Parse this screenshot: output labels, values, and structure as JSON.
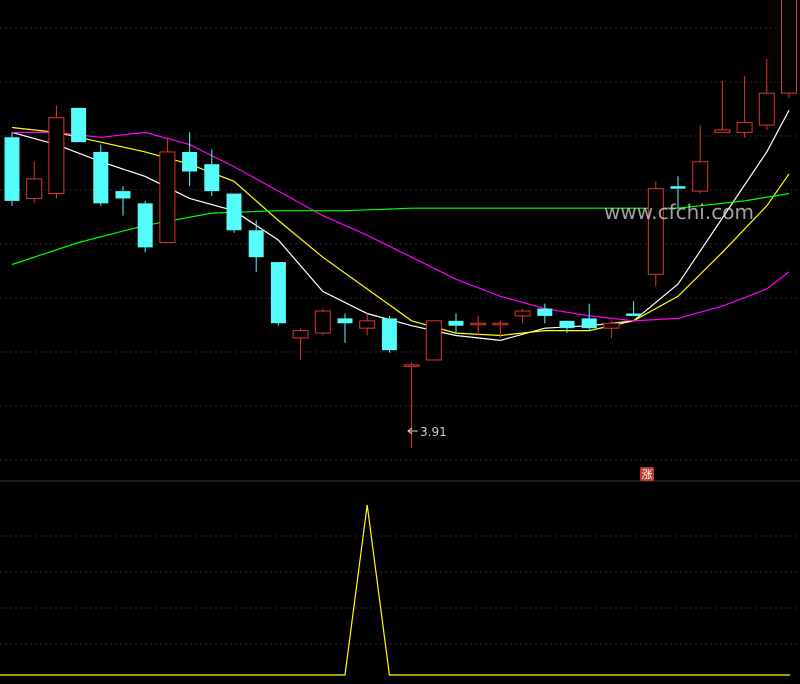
{
  "watermark": "www.cfchi.com",
  "badge": {
    "label": "涨",
    "color": "#c0392b"
  },
  "low_marker": {
    "label": "3.91",
    "value": 3.91
  },
  "colors": {
    "background": "#000000",
    "grid": "#2a2a2a",
    "rise": "#e03434",
    "fall": "#54fcfc",
    "ma5": "#ffffff",
    "ma10": "#ffff00",
    "ma20": "#ff00ff",
    "ma60": "#00ff00",
    "indicator": "#ffff00"
  },
  "chart_data": [
    {
      "type": "candlestick",
      "price_range": [
        3.8,
        5.7
      ],
      "gridlines": "horizontal-dashed",
      "candles": [
        {
          "o": 5.18,
          "h": 5.2,
          "c": 4.92,
          "l": 4.9
        },
        {
          "o": 4.93,
          "h": 5.08,
          "c": 5.01,
          "l": 4.91
        },
        {
          "o": 4.95,
          "h": 5.31,
          "c": 5.26,
          "l": 4.93
        },
        {
          "o": 5.3,
          "h": 5.3,
          "c": 5.16,
          "l": 5.16
        },
        {
          "o": 5.12,
          "h": 5.15,
          "c": 4.91,
          "l": 4.9
        },
        {
          "o": 4.96,
          "h": 4.98,
          "c": 4.93,
          "l": 4.86
        },
        {
          "o": 4.91,
          "h": 4.92,
          "c": 4.73,
          "l": 4.71
        },
        {
          "o": 4.75,
          "h": 5.18,
          "c": 5.12,
          "l": 4.75
        },
        {
          "o": 5.12,
          "h": 5.2,
          "c": 5.04,
          "l": 4.98
        },
        {
          "o": 5.07,
          "h": 5.13,
          "c": 4.96,
          "l": 4.94
        },
        {
          "o": 4.95,
          "h": 4.95,
          "c": 4.8,
          "l": 4.79
        },
        {
          "o": 4.8,
          "h": 4.84,
          "c": 4.69,
          "l": 4.63
        },
        {
          "o": 4.67,
          "h": 4.67,
          "c": 4.42,
          "l": 4.41
        },
        {
          "o": 4.36,
          "h": 4.4,
          "c": 4.39,
          "l": 4.27
        },
        {
          "o": 4.38,
          "h": 4.48,
          "c": 4.47,
          "l": 4.37
        },
        {
          "o": 4.44,
          "h": 4.46,
          "c": 4.42,
          "l": 4.34
        },
        {
          "o": 4.4,
          "h": 4.46,
          "c": 4.43,
          "l": 4.37
        },
        {
          "o": 4.44,
          "h": 4.45,
          "c": 4.31,
          "l": 4.3
        },
        {
          "o": 4.25,
          "h": 4.26,
          "c": 4.25,
          "l": 3.91
        },
        {
          "o": 4.27,
          "h": 4.43,
          "c": 4.43,
          "l": 4.27
        },
        {
          "o": 4.43,
          "h": 4.46,
          "c": 4.41,
          "l": 4.38
        },
        {
          "o": 4.42,
          "h": 4.45,
          "c": 4.42,
          "l": 4.37
        },
        {
          "o": 4.42,
          "h": 4.43,
          "c": 4.42,
          "l": 4.36
        },
        {
          "o": 4.45,
          "h": 4.48,
          "c": 4.47,
          "l": 4.42
        },
        {
          "o": 4.48,
          "h": 4.5,
          "c": 4.45,
          "l": 4.42
        },
        {
          "o": 4.43,
          "h": 4.43,
          "c": 4.4,
          "l": 4.38
        },
        {
          "o": 4.44,
          "h": 4.5,
          "c": 4.4,
          "l": 4.39
        },
        {
          "o": 4.4,
          "h": 4.43,
          "c": 4.42,
          "l": 4.36
        },
        {
          "o": 4.46,
          "h": 4.51,
          "c": 4.45,
          "l": 4.45
        },
        {
          "o": 4.62,
          "h": 5.0,
          "c": 4.97,
          "l": 4.57
        },
        {
          "o": 4.98,
          "h": 5.02,
          "c": 4.97,
          "l": 4.89
        },
        {
          "o": 4.96,
          "h": 5.23,
          "c": 5.08,
          "l": 4.95
        },
        {
          "o": 5.2,
          "h": 5.41,
          "c": 5.21,
          "l": 5.2
        },
        {
          "o": 5.2,
          "h": 5.43,
          "c": 5.24,
          "l": 5.18
        },
        {
          "o": 5.23,
          "h": 5.5,
          "c": 5.36,
          "l": 5.21
        },
        {
          "o": 5.36,
          "h": 5.8,
          "c": 5.8,
          "l": 5.34
        }
      ],
      "moving_averages": [
        {
          "key": "ma5",
          "values": [
            [
              0,
              5.2
            ],
            [
              2,
              5.15
            ],
            [
              4,
              5.08
            ],
            [
              6,
              5.02
            ],
            [
              8,
              4.93
            ],
            [
              10,
              4.88
            ],
            [
              12,
              4.76
            ],
            [
              14,
              4.55
            ],
            [
              16,
              4.46
            ],
            [
              18,
              4.41
            ],
            [
              20,
              4.37
            ],
            [
              22,
              4.35
            ],
            [
              24,
              4.4
            ],
            [
              26,
              4.41
            ],
            [
              28,
              4.43
            ],
            [
              30,
              4.58
            ],
            [
              32,
              4.85
            ],
            [
              34,
              5.12
            ],
            [
              35,
              5.29
            ]
          ]
        },
        {
          "key": "ma10",
          "values": [
            [
              0,
              5.22
            ],
            [
              2,
              5.2
            ],
            [
              4,
              5.16
            ],
            [
              6,
              5.12
            ],
            [
              8,
              5.07
            ],
            [
              10,
              5.0
            ],
            [
              12,
              4.84
            ],
            [
              14,
              4.69
            ],
            [
              16,
              4.56
            ],
            [
              18,
              4.43
            ],
            [
              20,
              4.38
            ],
            [
              22,
              4.37
            ],
            [
              24,
              4.39
            ],
            [
              26,
              4.39
            ],
            [
              28,
              4.43
            ],
            [
              30,
              4.53
            ],
            [
              32,
              4.71
            ],
            [
              34,
              4.9
            ],
            [
              35,
              5.03
            ]
          ]
        },
        {
          "key": "ma20",
          "values": [
            [
              0,
              5.2
            ],
            [
              2,
              5.2
            ],
            [
              4,
              5.18
            ],
            [
              6,
              5.2
            ],
            [
              8,
              5.15
            ],
            [
              10,
              5.06
            ],
            [
              12,
              4.96
            ],
            [
              14,
              4.86
            ],
            [
              16,
              4.78
            ],
            [
              18,
              4.69
            ],
            [
              20,
              4.6
            ],
            [
              22,
              4.53
            ],
            [
              24,
              4.48
            ],
            [
              26,
              4.45
            ],
            [
              28,
              4.43
            ],
            [
              30,
              4.44
            ],
            [
              32,
              4.49
            ],
            [
              34,
              4.56
            ],
            [
              35,
              4.63
            ]
          ]
        },
        {
          "key": "ma60",
          "values": [
            [
              0,
              4.66
            ],
            [
              3,
              4.75
            ],
            [
              6,
              4.82
            ],
            [
              9,
              4.87
            ],
            [
              12,
              4.88
            ],
            [
              15,
              4.88
            ],
            [
              18,
              4.89
            ],
            [
              21,
              4.89
            ],
            [
              24,
              4.89
            ],
            [
              27,
              4.89
            ],
            [
              30,
              4.89
            ],
            [
              33,
              4.92
            ],
            [
              35,
              4.95
            ]
          ]
        }
      ]
    },
    {
      "type": "line",
      "title": "",
      "ylim": [
        0,
        1
      ],
      "series": [
        {
          "key": "indicator",
          "values": [
            0,
            0,
            0,
            0,
            0,
            0,
            0,
            0,
            0,
            0,
            0,
            0,
            0,
            0,
            0,
            0,
            1,
            0,
            0,
            0,
            0,
            0,
            0,
            0,
            0,
            0,
            0,
            0,
            0,
            0,
            0,
            0,
            0,
            0,
            0,
            0
          ]
        }
      ]
    }
  ]
}
